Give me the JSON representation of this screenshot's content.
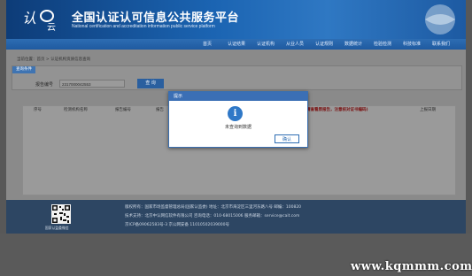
{
  "header": {
    "title": "全国认证认可信息公共服务平台",
    "subtitle": "National certification and accreditation information public service platform"
  },
  "nav": {
    "items": [
      "首页",
      "认证结果",
      "认证机构",
      "从业人员",
      "认证规则",
      "数据统计",
      "检验检测",
      "科技标准",
      "联系我们"
    ]
  },
  "breadcrumb": "当前位置：首页 > 认证机构资质信息查询",
  "search_panel": {
    "tab_label": "查询条件",
    "field_label": "报告编号",
    "field_value": "2317000042553",
    "query_button": "查 询"
  },
  "table": {
    "columns": [
      "序号",
      "检测机构名称",
      "报告编号",
      "报告",
      "(请查看原报告，注意核对证书编码)",
      "上报日期"
    ]
  },
  "dialog": {
    "title": "提示",
    "icon": "info-icon",
    "message": "未查询到数据",
    "ok_button": "确认"
  },
  "footer": {
    "qr_caption": "国家认监委微信",
    "lines": [
      "版权所有：国家市场监督管理总局(国家认监委)  地址：北京市海淀区三里河东路八号  邮编：100820",
      "技术支持：北京中认网信软件有限公司  咨询电话：010-68015006  服务邮箱：service@cait.com",
      "京ICP备09062583号-3  京公网安备  11010502039000号"
    ]
  },
  "watermark": "www.kqmmm.com",
  "colors": {
    "header": "#1b64b2",
    "dialog_title": "#3b6fb5",
    "footer": "#2d4663",
    "warning_text": "#7a1010"
  }
}
